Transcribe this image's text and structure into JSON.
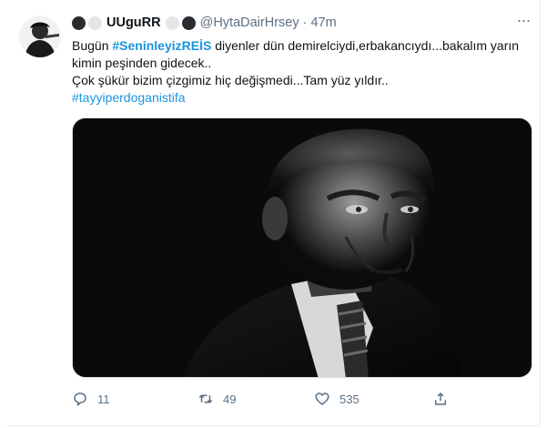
{
  "tweet": {
    "display_name": "UUguRR",
    "handle": "@HytaDairHrsey",
    "separator": "·",
    "time": "47m",
    "more_label": "···",
    "text": {
      "line1_pre": "Bugün ",
      "hashtag1": "#SeninleyizREİS",
      "line1_post": " diyenler dün demirelciydi,erbakancıydı...bakalım yarın kimin peşinden gidecek..",
      "line2": "Çok şükür bizim çizgimiz hiç değişmedi...Tam yüz yıldır..",
      "hashtag2": "#tayyiperdoganistifa"
    },
    "actions": {
      "replies": "11",
      "retweets": "49",
      "likes": "535"
    }
  },
  "colors": {
    "accent": "#1b95e0",
    "text": "#0f1419",
    "muted": "#5b7083"
  },
  "icons": [
    "avatar",
    "more-icon",
    "reply-icon",
    "retweet-icon",
    "like-icon",
    "share-icon"
  ]
}
